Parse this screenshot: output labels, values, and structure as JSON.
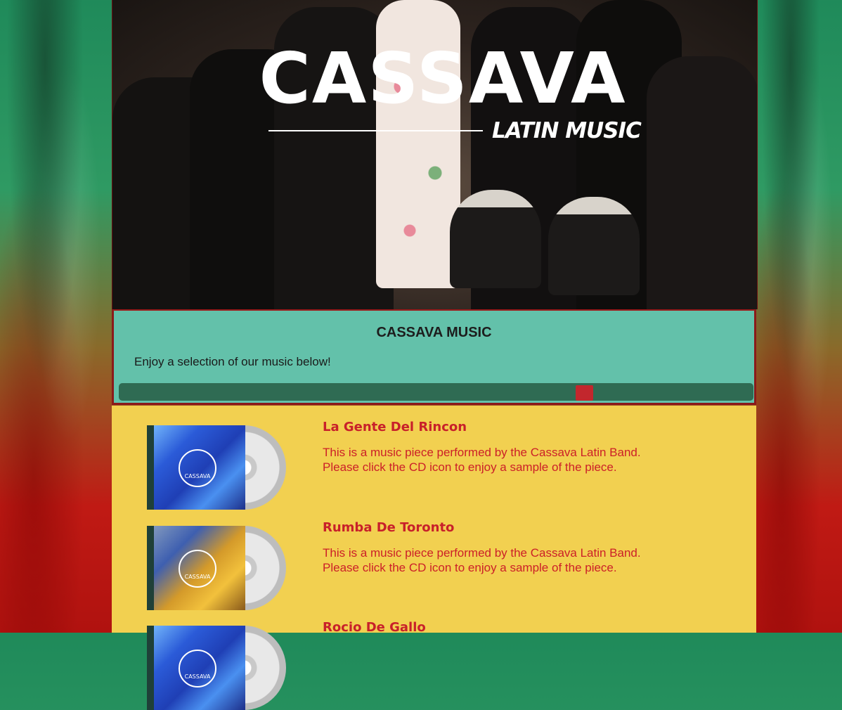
{
  "hero": {
    "logo_title": "CASSAVA",
    "logo_subtitle": "LATIN MUSIC"
  },
  "intro": {
    "title": "CASSAVA MUSIC",
    "subtitle": "Enjoy a selection of our music below!"
  },
  "scrollbar": {
    "position_fraction": 0.74
  },
  "tracks": [
    {
      "title": "La Gente Del Rincon",
      "line1": "This is a music piece performed by the Cassava Latin Band.",
      "line2": "Please click the CD icon to enjoy a sample of the piece.",
      "cd_label": "CASSAVA"
    },
    {
      "title": "Rumba De Toronto",
      "line1": "This is a music piece performed by the Cassava Latin Band.",
      "line2": "Please click the CD icon to enjoy a sample of the piece.",
      "cd_label": "CASSAVA"
    },
    {
      "title": "Rocio De Gallo",
      "cd_label": "CASSAVA"
    }
  ],
  "colors": {
    "track_text": "#cc1f28",
    "intro_bg": "#63c1aa",
    "music_bg": "#f2d050",
    "scroll_thumb": "#c2272d"
  }
}
